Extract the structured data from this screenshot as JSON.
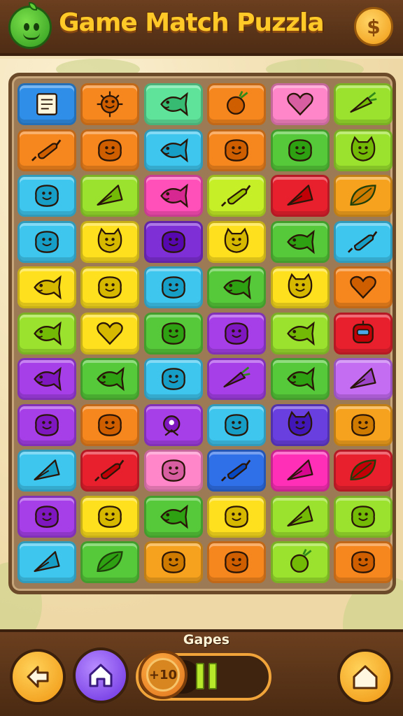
{
  "header": {
    "title": "Game Match Puzzla",
    "coin_symbol": "$"
  },
  "footer": {
    "goal_label": "Gapes",
    "badge_text": "+10",
    "progress_fraction": 0.12
  },
  "icons": {
    "back": "arrow-back-icon",
    "home": "home-icon",
    "pause": "pause-icon",
    "right": "house-outline-icon"
  },
  "colors": {
    "header_bg": "#5a3318",
    "board_bg": "#9b7a55",
    "title": "#ffc928"
  },
  "board": {
    "rows": [
      [
        {
          "color": "#2f8fe8",
          "icon": "note-card"
        },
        {
          "color": "#f6861e",
          "icon": "sun-fish"
        },
        {
          "color": "#5fe39a",
          "icon": "fish"
        },
        {
          "color": "#f6861e",
          "icon": "radish"
        },
        {
          "color": "#ff86c8",
          "icon": "heart"
        },
        {
          "color": "#9be22f",
          "icon": "carrot"
        }
      ],
      [
        {
          "color": "#f6861e",
          "icon": "candy"
        },
        {
          "color": "#f6861e",
          "icon": "blob"
        },
        {
          "color": "#3fc6ef",
          "icon": "fish"
        },
        {
          "color": "#f6861e",
          "icon": "blob"
        },
        {
          "color": "#55c93a",
          "icon": "blob"
        },
        {
          "color": "#9be22f",
          "icon": "cat"
        }
      ],
      [
        {
          "color": "#3fc6ef",
          "icon": "blob"
        },
        {
          "color": "#9be22f",
          "icon": "kite"
        },
        {
          "color": "#ff4fb8",
          "icon": "fish"
        },
        {
          "color": "#c7ef28",
          "icon": "candy"
        },
        {
          "color": "#e8202e",
          "icon": "kite"
        },
        {
          "color": "#f6a21e",
          "icon": "leaf"
        }
      ],
      [
        {
          "color": "#3fc6ef",
          "icon": "blob"
        },
        {
          "color": "#ffe01f",
          "icon": "cat"
        },
        {
          "color": "#7f2fd6",
          "icon": "blob"
        },
        {
          "color": "#ffe01f",
          "icon": "cat"
        },
        {
          "color": "#55c93a",
          "icon": "fish"
        },
        {
          "color": "#3fc6ef",
          "icon": "candy"
        }
      ],
      [
        {
          "color": "#ffe01f",
          "icon": "fish"
        },
        {
          "color": "#ffe01f",
          "icon": "blob"
        },
        {
          "color": "#3fc6ef",
          "icon": "blob"
        },
        {
          "color": "#55c93a",
          "icon": "fish"
        },
        {
          "color": "#ffe01f",
          "icon": "cat"
        },
        {
          "color": "#f6861e",
          "icon": "heart"
        }
      ],
      [
        {
          "color": "#9be22f",
          "icon": "fish"
        },
        {
          "color": "#ffe01f",
          "icon": "heart"
        },
        {
          "color": "#55c93a",
          "icon": "blob"
        },
        {
          "color": "#a63fe8",
          "icon": "blob"
        },
        {
          "color": "#9be22f",
          "icon": "fish"
        },
        {
          "color": "#e8202e",
          "icon": "robot"
        }
      ],
      [
        {
          "color": "#a63fe8",
          "icon": "fish"
        },
        {
          "color": "#55c93a",
          "icon": "fish"
        },
        {
          "color": "#3fc6ef",
          "icon": "blob"
        },
        {
          "color": "#a63fe8",
          "icon": "carrot"
        },
        {
          "color": "#55c93a",
          "icon": "fish"
        },
        {
          "color": "#c46cf2",
          "icon": "kite"
        }
      ],
      [
        {
          "color": "#a63fe8",
          "icon": "blob"
        },
        {
          "color": "#f6861e",
          "icon": "blob"
        },
        {
          "color": "#a63fe8",
          "icon": "bird"
        },
        {
          "color": "#3fc6ef",
          "icon": "blob"
        },
        {
          "color": "#6a3fe0",
          "icon": "cat"
        },
        {
          "color": "#f6a21e",
          "icon": "blob"
        }
      ],
      [
        {
          "color": "#3fc6ef",
          "icon": "kite"
        },
        {
          "color": "#e8202e",
          "icon": "candy"
        },
        {
          "color": "#ff86c8",
          "icon": "blob"
        },
        {
          "color": "#2f6fe8",
          "icon": "candy"
        },
        {
          "color": "#ff2fb8",
          "icon": "kite"
        },
        {
          "color": "#e8202e",
          "icon": "leaf"
        }
      ],
      [
        {
          "color": "#a63fe8",
          "icon": "blob"
        },
        {
          "color": "#ffe01f",
          "icon": "blob"
        },
        {
          "color": "#55c93a",
          "icon": "fish"
        },
        {
          "color": "#ffe01f",
          "icon": "blob"
        },
        {
          "color": "#9be22f",
          "icon": "kite"
        },
        {
          "color": "#9be22f",
          "icon": "blob"
        }
      ],
      [
        {
          "color": "#3fc6ef",
          "icon": "kite"
        },
        {
          "color": "#55c93a",
          "icon": "leaf"
        },
        {
          "color": "#f6a21e",
          "icon": "blob"
        },
        {
          "color": "#f6861e",
          "icon": "blob"
        },
        {
          "color": "#9be22f",
          "icon": "radish"
        },
        {
          "color": "#f6861e",
          "icon": "blob"
        }
      ]
    ]
  }
}
